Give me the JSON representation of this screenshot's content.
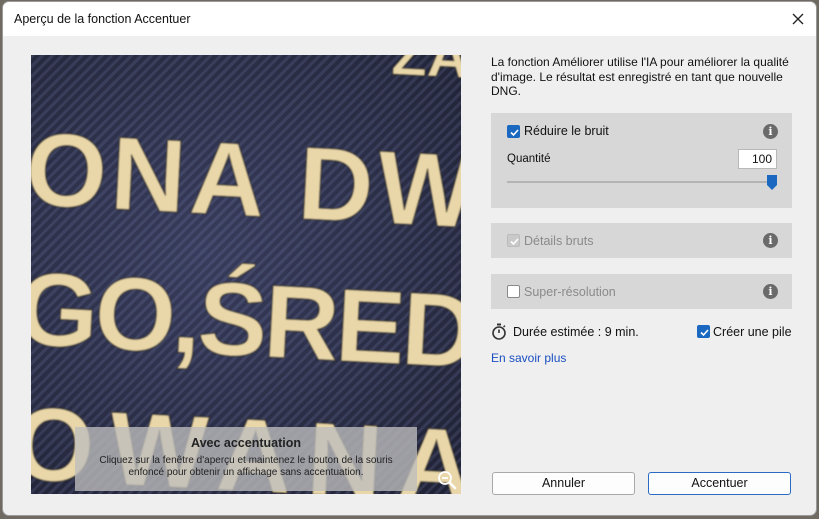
{
  "dialog": {
    "title": "Aperçu de la fonction Accentuer"
  },
  "preview": {
    "lines": [
      "ONA DW",
      "GO,ŚRED",
      "OWANA"
    ],
    "top_line": "ZA",
    "overlay_title": "Avec accentuation",
    "overlay_body": "Cliquez sur la fenêtre d'aperçu et maintenez le bouton de la souris enfoncé pour obtenir un affichage sans accentuation."
  },
  "description": "La fonction Améliorer utilise l'IA pour améliorer la qualité d'image. Le résultat est enregistré en tant que nouvelle DNG.",
  "options": {
    "denoise": {
      "label": "Réduire le bruit",
      "checked": true
    },
    "quantity_label": "Quantité",
    "quantity_value": "100",
    "quantity_fraction": 1.0,
    "raw_details": {
      "label": "Détails bruts",
      "checked": true,
      "disabled": true
    },
    "super_resolution": {
      "label": "Super-résolution",
      "checked": false
    }
  },
  "duration_text": "Durée estimée : 9 min.",
  "create_stack_label": "Créer une pile",
  "learn_more": "En savoir plus",
  "buttons": {
    "cancel": "Annuler",
    "apply": "Accentuer"
  },
  "colors": {
    "accent": "#1a68bf",
    "link": "#1a4fc2",
    "panel": "#d7d7d7"
  }
}
